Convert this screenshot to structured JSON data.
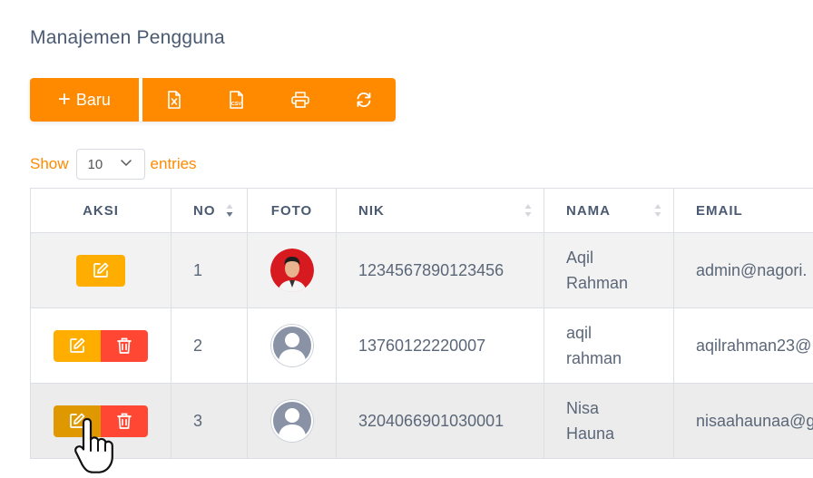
{
  "page": {
    "title": "Manajemen Pengguna"
  },
  "toolbar": {
    "new_label": "Baru",
    "new_icon": "plus",
    "icons": [
      "excel-export-icon",
      "csv-export-icon",
      "print-icon",
      "refresh-icon"
    ],
    "accent": "#ff8a00"
  },
  "length_menu": {
    "show_label": "Show",
    "value": "10",
    "entries_label": "entries"
  },
  "table": {
    "headers": {
      "aksi": "AKSI",
      "no": "NO",
      "foto": "FOTO",
      "nik": "NIK",
      "nama": "NAMA",
      "email": "EMAIL"
    },
    "rows": [
      {
        "no": "1",
        "nik": "1234567890123456",
        "nama_line1": "Aqil",
        "nama_line2": "Rahman",
        "email": "admin@nagori.",
        "photo": "user-photo",
        "actions": [
          "edit"
        ]
      },
      {
        "no": "2",
        "nik": "13760122220007",
        "nama_line1": "aqil",
        "nama_line2": "rahman",
        "email": "aqilrahman23@",
        "photo": "default-avatar",
        "actions": [
          "edit",
          "delete"
        ]
      },
      {
        "no": "3",
        "nik": "3204066901030001",
        "nama_line1": "Nisa",
        "nama_line2": "Hauna",
        "email": "nisaahaunaa@g",
        "photo": "default-avatar",
        "actions": [
          "edit",
          "delete"
        ]
      }
    ]
  },
  "colors": {
    "edit": "#ffae00",
    "delete": "#ff4733",
    "title": "#4a5a72"
  }
}
